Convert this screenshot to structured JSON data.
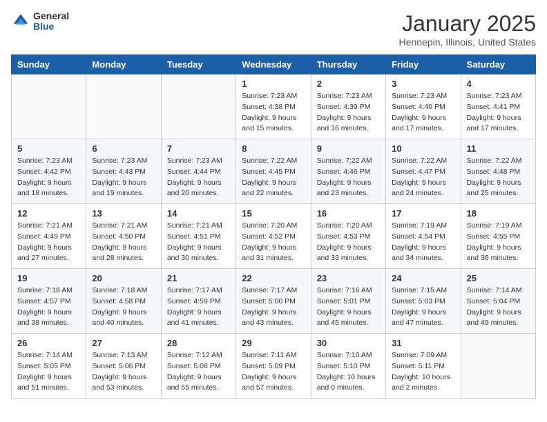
{
  "logo": {
    "general": "General",
    "blue": "Blue"
  },
  "header": {
    "month": "January 2025",
    "location": "Hennepin, Illinois, United States"
  },
  "weekdays": [
    "Sunday",
    "Monday",
    "Tuesday",
    "Wednesday",
    "Thursday",
    "Friday",
    "Saturday"
  ],
  "weeks": [
    [
      {
        "day": "",
        "sunrise": "",
        "sunset": "",
        "daylight": ""
      },
      {
        "day": "",
        "sunrise": "",
        "sunset": "",
        "daylight": ""
      },
      {
        "day": "",
        "sunrise": "",
        "sunset": "",
        "daylight": ""
      },
      {
        "day": "1",
        "sunrise": "Sunrise: 7:23 AM",
        "sunset": "Sunset: 4:38 PM",
        "daylight": "Daylight: 9 hours and 15 minutes."
      },
      {
        "day": "2",
        "sunrise": "Sunrise: 7:23 AM",
        "sunset": "Sunset: 4:39 PM",
        "daylight": "Daylight: 9 hours and 16 minutes."
      },
      {
        "day": "3",
        "sunrise": "Sunrise: 7:23 AM",
        "sunset": "Sunset: 4:40 PM",
        "daylight": "Daylight: 9 hours and 17 minutes."
      },
      {
        "day": "4",
        "sunrise": "Sunrise: 7:23 AM",
        "sunset": "Sunset: 4:41 PM",
        "daylight": "Daylight: 9 hours and 17 minutes."
      }
    ],
    [
      {
        "day": "5",
        "sunrise": "Sunrise: 7:23 AM",
        "sunset": "Sunset: 4:42 PM",
        "daylight": "Daylight: 9 hours and 18 minutes."
      },
      {
        "day": "6",
        "sunrise": "Sunrise: 7:23 AM",
        "sunset": "Sunset: 4:43 PM",
        "daylight": "Daylight: 9 hours and 19 minutes."
      },
      {
        "day": "7",
        "sunrise": "Sunrise: 7:23 AM",
        "sunset": "Sunset: 4:44 PM",
        "daylight": "Daylight: 9 hours and 20 minutes."
      },
      {
        "day": "8",
        "sunrise": "Sunrise: 7:22 AM",
        "sunset": "Sunset: 4:45 PM",
        "daylight": "Daylight: 9 hours and 22 minutes."
      },
      {
        "day": "9",
        "sunrise": "Sunrise: 7:22 AM",
        "sunset": "Sunset: 4:46 PM",
        "daylight": "Daylight: 9 hours and 23 minutes."
      },
      {
        "day": "10",
        "sunrise": "Sunrise: 7:22 AM",
        "sunset": "Sunset: 4:47 PM",
        "daylight": "Daylight: 9 hours and 24 minutes."
      },
      {
        "day": "11",
        "sunrise": "Sunrise: 7:22 AM",
        "sunset": "Sunset: 4:48 PM",
        "daylight": "Daylight: 9 hours and 25 minutes."
      }
    ],
    [
      {
        "day": "12",
        "sunrise": "Sunrise: 7:21 AM",
        "sunset": "Sunset: 4:49 PM",
        "daylight": "Daylight: 9 hours and 27 minutes."
      },
      {
        "day": "13",
        "sunrise": "Sunrise: 7:21 AM",
        "sunset": "Sunset: 4:50 PM",
        "daylight": "Daylight: 9 hours and 28 minutes."
      },
      {
        "day": "14",
        "sunrise": "Sunrise: 7:21 AM",
        "sunset": "Sunset: 4:51 PM",
        "daylight": "Daylight: 9 hours and 30 minutes."
      },
      {
        "day": "15",
        "sunrise": "Sunrise: 7:20 AM",
        "sunset": "Sunset: 4:52 PM",
        "daylight": "Daylight: 9 hours and 31 minutes."
      },
      {
        "day": "16",
        "sunrise": "Sunrise: 7:20 AM",
        "sunset": "Sunset: 4:53 PM",
        "daylight": "Daylight: 9 hours and 33 minutes."
      },
      {
        "day": "17",
        "sunrise": "Sunrise: 7:19 AM",
        "sunset": "Sunset: 4:54 PM",
        "daylight": "Daylight: 9 hours and 34 minutes."
      },
      {
        "day": "18",
        "sunrise": "Sunrise: 7:19 AM",
        "sunset": "Sunset: 4:55 PM",
        "daylight": "Daylight: 9 hours and 36 minutes."
      }
    ],
    [
      {
        "day": "19",
        "sunrise": "Sunrise: 7:18 AM",
        "sunset": "Sunset: 4:57 PM",
        "daylight": "Daylight: 9 hours and 38 minutes."
      },
      {
        "day": "20",
        "sunrise": "Sunrise: 7:18 AM",
        "sunset": "Sunset: 4:58 PM",
        "daylight": "Daylight: 9 hours and 40 minutes."
      },
      {
        "day": "21",
        "sunrise": "Sunrise: 7:17 AM",
        "sunset": "Sunset: 4:59 PM",
        "daylight": "Daylight: 9 hours and 41 minutes."
      },
      {
        "day": "22",
        "sunrise": "Sunrise: 7:17 AM",
        "sunset": "Sunset: 5:00 PM",
        "daylight": "Daylight: 9 hours and 43 minutes."
      },
      {
        "day": "23",
        "sunrise": "Sunrise: 7:16 AM",
        "sunset": "Sunset: 5:01 PM",
        "daylight": "Daylight: 9 hours and 45 minutes."
      },
      {
        "day": "24",
        "sunrise": "Sunrise: 7:15 AM",
        "sunset": "Sunset: 5:03 PM",
        "daylight": "Daylight: 9 hours and 47 minutes."
      },
      {
        "day": "25",
        "sunrise": "Sunrise: 7:14 AM",
        "sunset": "Sunset: 5:04 PM",
        "daylight": "Daylight: 9 hours and 49 minutes."
      }
    ],
    [
      {
        "day": "26",
        "sunrise": "Sunrise: 7:14 AM",
        "sunset": "Sunset: 5:05 PM",
        "daylight": "Daylight: 9 hours and 51 minutes."
      },
      {
        "day": "27",
        "sunrise": "Sunrise: 7:13 AM",
        "sunset": "Sunset: 5:06 PM",
        "daylight": "Daylight: 9 hours and 53 minutes."
      },
      {
        "day": "28",
        "sunrise": "Sunrise: 7:12 AM",
        "sunset": "Sunset: 5:08 PM",
        "daylight": "Daylight: 9 hours and 55 minutes."
      },
      {
        "day": "29",
        "sunrise": "Sunrise: 7:11 AM",
        "sunset": "Sunset: 5:09 PM",
        "daylight": "Daylight: 9 hours and 57 minutes."
      },
      {
        "day": "30",
        "sunrise": "Sunrise: 7:10 AM",
        "sunset": "Sunset: 5:10 PM",
        "daylight": "Daylight: 10 hours and 0 minutes."
      },
      {
        "day": "31",
        "sunrise": "Sunrise: 7:09 AM",
        "sunset": "Sunset: 5:11 PM",
        "daylight": "Daylight: 10 hours and 2 minutes."
      },
      {
        "day": "",
        "sunrise": "",
        "sunset": "",
        "daylight": ""
      }
    ]
  ]
}
